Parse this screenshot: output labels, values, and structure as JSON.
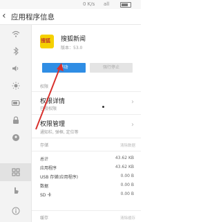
{
  "status_bar": {
    "left_text": "0 K/s",
    "signal": "all",
    "battery_level": 0.8
  },
  "header": {
    "back_icon": "arrow-back-icon",
    "title": "应用程序信息"
  },
  "sidebar": {
    "items": [
      {
        "icon": "wifi-icon"
      },
      {
        "icon": "bluetooth-icon"
      },
      {
        "icon": "volume-icon"
      },
      {
        "icon": "brightness-icon"
      },
      {
        "icon": "battery-icon"
      },
      {
        "icon": "lock-icon"
      },
      {
        "icon": "location-icon"
      },
      {
        "icon": "apps-grid-icon",
        "active": true
      },
      {
        "icon": "hand-icon"
      },
      {
        "icon": "info-icon"
      }
    ]
  },
  "app": {
    "name": "搜狐新闻",
    "version": "版本：53.0",
    "icon_text": "搜狐"
  },
  "buttons": {
    "move": "移动",
    "force_stop": "强行停止"
  },
  "permissions": {
    "section": "权限",
    "detail_title": "权限详情",
    "detail_sub": "已授权限",
    "manage_title": "权限管理",
    "manage_sub": "通知栏, 弹框, 定位等"
  },
  "storage": {
    "section": "存储",
    "clear_label": "清除数据",
    "rows": [
      {
        "label": "总计",
        "value": "43.62 KB"
      },
      {
        "label": "应用程序",
        "value": "43.62 KB"
      },
      {
        "label": "USB 存储(应用程序)",
        "value": "0.00 B"
      },
      {
        "label": "数据",
        "value": "0.00 B"
      },
      {
        "label": "SD 卡",
        "value": "0.00 B"
      }
    ]
  },
  "cache": {
    "section": "缓存",
    "clear_label": "清除缓存"
  },
  "colors": {
    "accent": "#2f8de4",
    "annotation_arrow": "#d9302c",
    "app_icon_bg": "#f5d100"
  }
}
